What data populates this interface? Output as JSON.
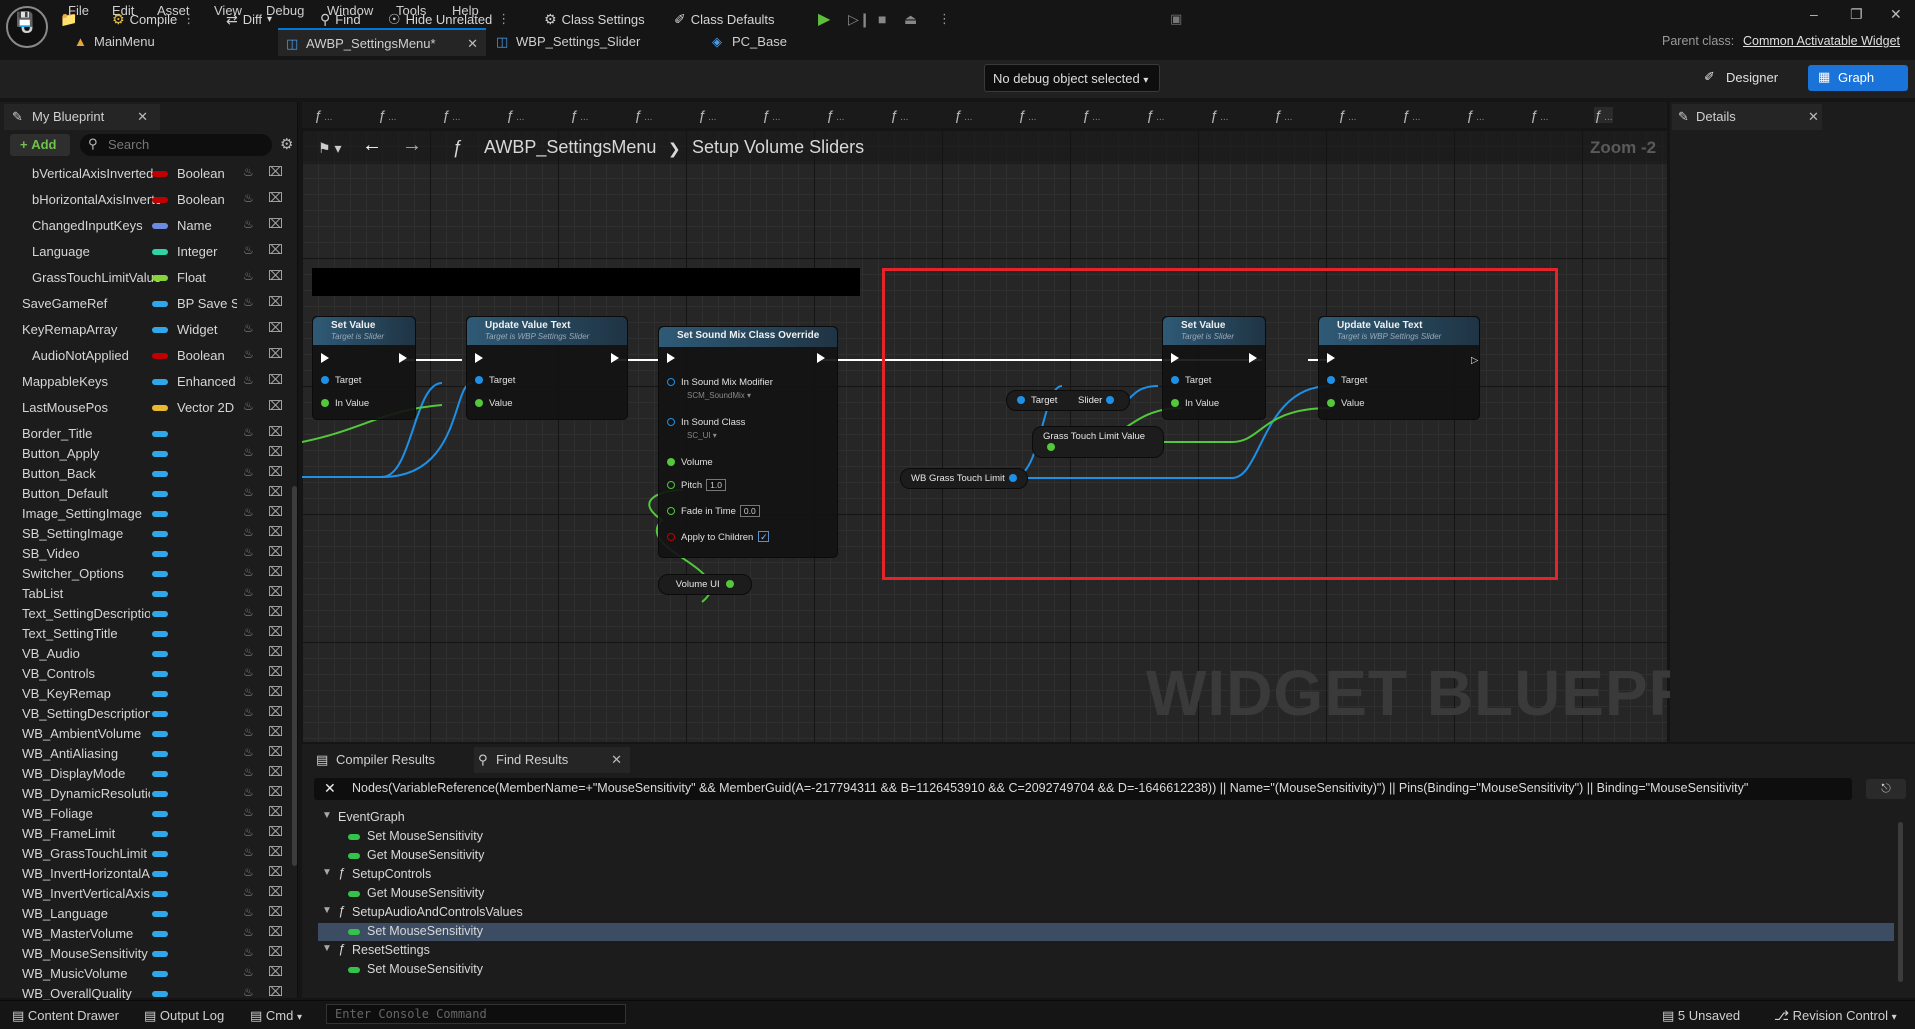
{
  "menu": [
    "File",
    "Edit",
    "Asset",
    "View",
    "Debug",
    "Window",
    "Tools",
    "Help"
  ],
  "tabs": [
    {
      "label": "MainMenu",
      "active": false
    },
    {
      "label": "AWBP_SettingsMenu*",
      "active": true
    },
    {
      "label": "WBP_Settings_Slider",
      "active": false
    },
    {
      "label": "PC_Base",
      "active": false
    }
  ],
  "parent_class_label": "Parent class:",
  "parent_class_value": "Common Activatable Widget",
  "toolbar": {
    "compile": "Compile",
    "diff": "Diff",
    "find": "Find",
    "hide_unrelated": "Hide Unrelated",
    "class_settings": "Class Settings",
    "class_defaults": "Class Defaults",
    "debug_object": "No debug object selected",
    "designer": "Designer",
    "graph": "Graph"
  },
  "my_blueprint": {
    "title": "My Blueprint",
    "add": "Add",
    "search_placeholder": "Search",
    "variables": [
      {
        "name": "bVerticalAxisInverted",
        "type": "Boolean",
        "color": "#c00000"
      },
      {
        "name": "bHorizontalAxisInverted",
        "type": "Boolean",
        "color": "#c00000"
      },
      {
        "name": "ChangedInputKeys",
        "type": "Name",
        "color": "#6c8be0"
      },
      {
        "name": "Language",
        "type": "Integer",
        "color": "#2fd3a4"
      },
      {
        "name": "GrassTouchLimitValue",
        "type": "Float",
        "color": "#8ad23a"
      },
      {
        "name": "SaveGameRef",
        "type": "BP Save Settings",
        "color": "#30a7e8"
      },
      {
        "name": "KeyRemapArray",
        "type": "Widget",
        "color": "#30a7e8"
      },
      {
        "name": "AudioNotApplied",
        "type": "Boolean",
        "color": "#c00000"
      },
      {
        "name": "MappableKeys",
        "type": "Enhanced Action Key Mapping",
        "color": "#30a7e8"
      },
      {
        "name": "LastMousePos",
        "type": "Vector 2D",
        "color": "#e8b82f"
      },
      {
        "name": "Border_Title",
        "type": "",
        "color": "#30a7e8"
      },
      {
        "name": "Button_Apply",
        "type": "",
        "color": "#30a7e8"
      },
      {
        "name": "Button_Back",
        "type": "",
        "color": "#30a7e8"
      },
      {
        "name": "Button_Default",
        "type": "",
        "color": "#30a7e8"
      },
      {
        "name": "Image_SettingImage",
        "type": "",
        "color": "#30a7e8"
      },
      {
        "name": "SB_SettingImage",
        "type": "",
        "color": "#30a7e8"
      },
      {
        "name": "SB_Video",
        "type": "",
        "color": "#30a7e8"
      },
      {
        "name": "Switcher_Options",
        "type": "",
        "color": "#30a7e8"
      },
      {
        "name": "TabList",
        "type": "",
        "color": "#30a7e8"
      },
      {
        "name": "Text_SettingDescription",
        "type": "",
        "color": "#30a7e8"
      },
      {
        "name": "Text_SettingTitle",
        "type": "",
        "color": "#30a7e8"
      },
      {
        "name": "VB_Audio",
        "type": "",
        "color": "#30a7e8"
      },
      {
        "name": "VB_Controls",
        "type": "",
        "color": "#30a7e8"
      },
      {
        "name": "VB_KeyRemap",
        "type": "",
        "color": "#30a7e8"
      },
      {
        "name": "VB_SettingDescription",
        "type": "",
        "color": "#30a7e8"
      },
      {
        "name": "WB_AmbientVolume",
        "type": "",
        "color": "#30a7e8"
      },
      {
        "name": "WB_AntiAliasing",
        "type": "",
        "color": "#30a7e8"
      },
      {
        "name": "WB_DisplayMode",
        "type": "",
        "color": "#30a7e8"
      },
      {
        "name": "WB_DynamicResolution",
        "type": "",
        "color": "#30a7e8"
      },
      {
        "name": "WB_Foliage",
        "type": "",
        "color": "#30a7e8"
      },
      {
        "name": "WB_FrameLimit",
        "type": "",
        "color": "#30a7e8"
      },
      {
        "name": "WB_GrassTouchLimit",
        "type": "",
        "color": "#30a7e8"
      },
      {
        "name": "WB_InvertHorizontalAxis",
        "type": "",
        "color": "#30a7e8"
      },
      {
        "name": "WB_InvertVerticalAxis",
        "type": "",
        "color": "#30a7e8"
      },
      {
        "name": "WB_Language",
        "type": "",
        "color": "#30a7e8"
      },
      {
        "name": "WB_MasterVolume",
        "type": "",
        "color": "#30a7e8"
      },
      {
        "name": "WB_MouseSensitivity",
        "type": "",
        "color": "#30a7e8"
      },
      {
        "name": "WB_MusicVolume",
        "type": "",
        "color": "#30a7e8"
      },
      {
        "name": "WB_OverallQuality",
        "type": "",
        "color": "#30a7e8"
      }
    ]
  },
  "graph": {
    "breadcrumb_root": "AWBP_SettingsMenu",
    "breadcrumb_leaf": "Setup Volume Sliders",
    "zoom": "Zoom -2",
    "watermark": "WIDGET BLUEPRINT",
    "nodes": {
      "set_value_1": {
        "title": "Set Value",
        "subtitle": "Target is Slider",
        "pins": [
          "Target",
          "In Value"
        ]
      },
      "update_value_text_1": {
        "title": "Update Value Text",
        "subtitle": "Target is WBP Settings Slider",
        "pins": [
          "Target",
          "Value"
        ]
      },
      "set_sound_mix": {
        "title": "Set Sound Mix Class Override",
        "pins": [
          "In Sound Mix Modifier",
          "In Sound Class",
          "Volume",
          "Pitch",
          "Fade in Time",
          "Apply to Children"
        ],
        "mix_value": "SCM_SoundMix",
        "class_value": "SC_UI",
        "pitch": "1.0",
        "fade": "0.0"
      },
      "volume_ui": "Volume UI",
      "target_slider": {
        "target": "Target",
        "slider": "Slider"
      },
      "grass_touch_limit_value": "Grass Touch Limit Value",
      "wb_grass_touch_limit": "WB Grass Touch Limit",
      "set_value_2": {
        "title": "Set Value",
        "subtitle": "Target is Slider",
        "pins": [
          "Target",
          "In Value"
        ]
      },
      "update_value_text_2": {
        "title": "Update Value Text",
        "subtitle": "Target is WBP Settings Slider",
        "pins": [
          "Target",
          "Value"
        ]
      }
    }
  },
  "details": {
    "title": "Details"
  },
  "results": {
    "tabs": [
      "Compiler Results",
      "Find Results"
    ],
    "query": "Nodes(VariableReference(MemberName=+\"MouseSensitivity\" && MemberGuid(A=-217794311 && B=1126453910 && C=2092749704 && D=-1646612238)) || Name=\"(MouseSensitivity)\") || Pins(Binding=\"MouseSensitivity\") || Binding=\"MouseSensitivity\"",
    "tree": [
      {
        "label": "EventGraph",
        "level": 0,
        "fn": false
      },
      {
        "label": "Set MouseSensitivity",
        "level": 1
      },
      {
        "label": "Get MouseSensitivity",
        "level": 1
      },
      {
        "label": "SetupControls",
        "level": 0,
        "fn": true
      },
      {
        "label": "Get MouseSensitivity",
        "level": 1
      },
      {
        "label": "SetupAudioAndControlsValues",
        "level": 0,
        "fn": true
      },
      {
        "label": "Set MouseSensitivity",
        "level": 1,
        "selected": true
      },
      {
        "label": "ResetSettings",
        "level": 0,
        "fn": true
      },
      {
        "label": "Set MouseSensitivity",
        "level": 1
      }
    ]
  },
  "statusbar": {
    "content_drawer": "Content Drawer",
    "output_log": "Output Log",
    "cmd": "Cmd",
    "console_placeholder": "Enter Console Command",
    "unsaved": "5 Unsaved",
    "revision": "Revision Control"
  }
}
